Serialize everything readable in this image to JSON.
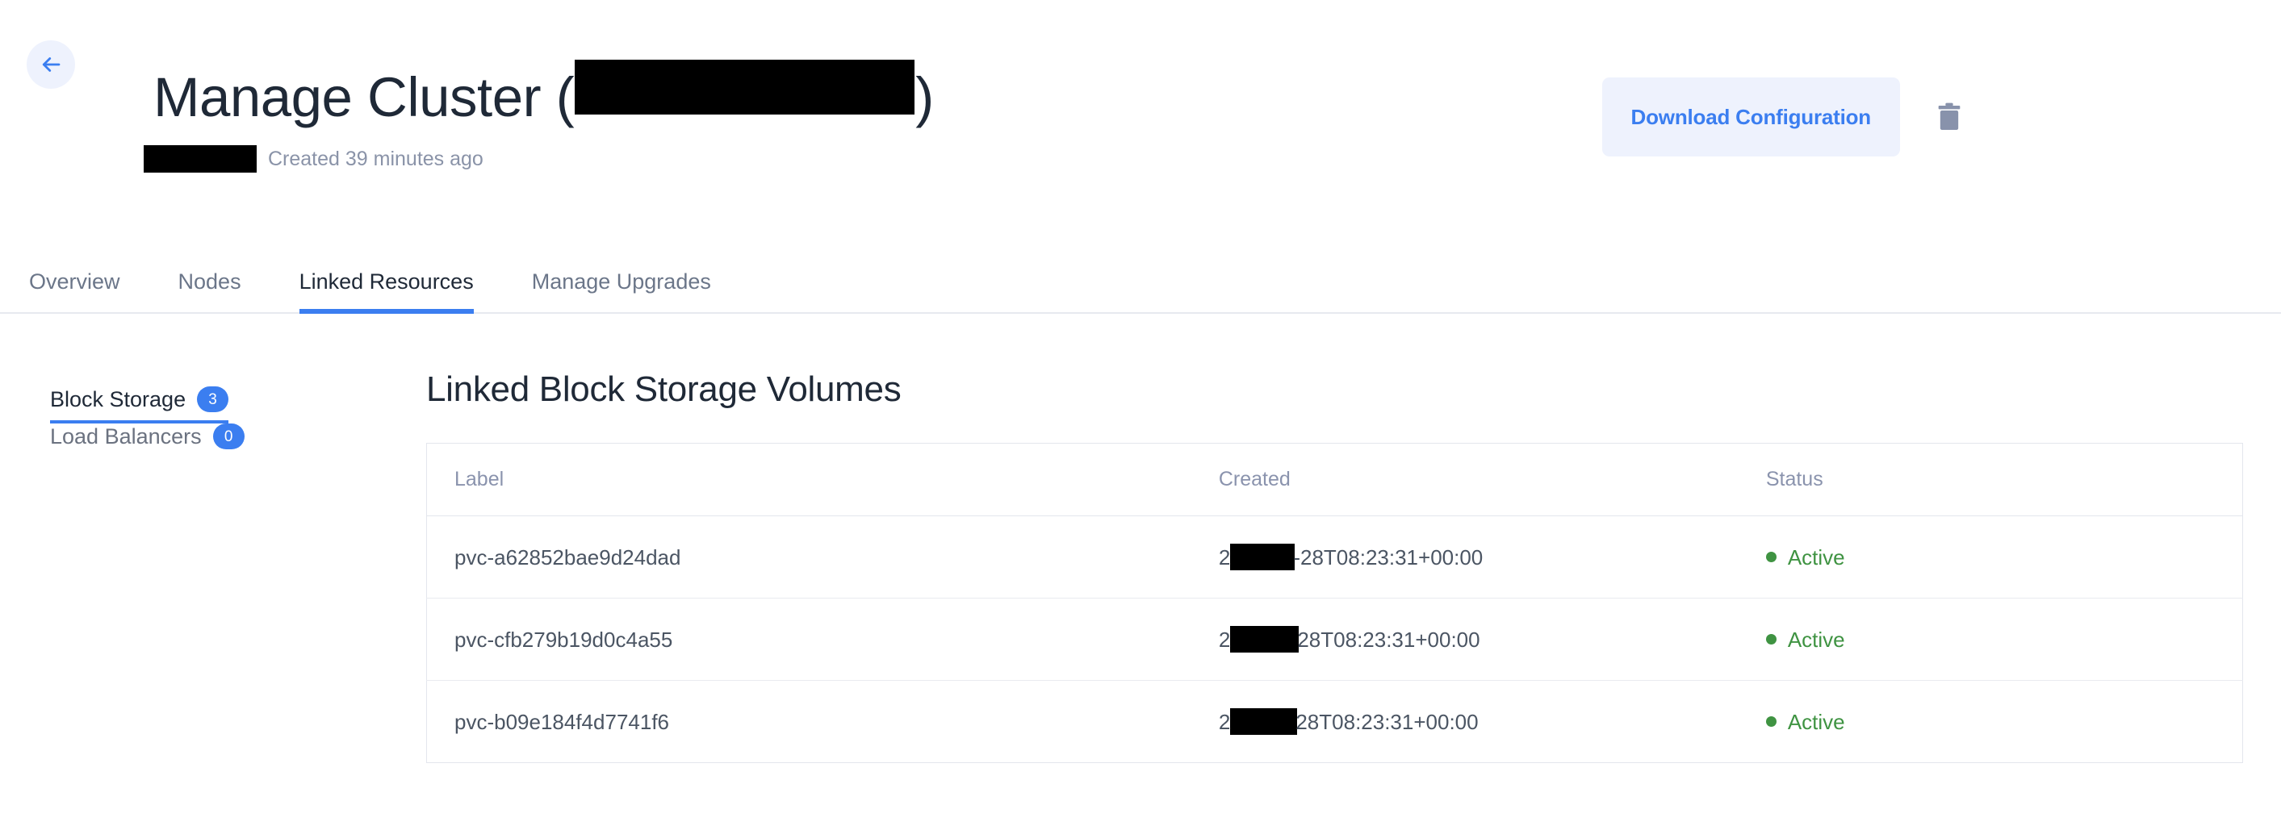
{
  "header": {
    "back_icon": "arrow-left-icon",
    "title_prefix": "Manage Cluster (",
    "title_suffix": ")",
    "title_redacted": true,
    "region_redacted": true,
    "subtitle": "Created 39 minutes ago",
    "download_label": "Download Configuration",
    "delete_icon": "trash-icon",
    "accent_color": "#3b7ef0",
    "button_bg": "#eef2fd"
  },
  "tabs": [
    {
      "label": "Overview",
      "active": false
    },
    {
      "label": "Nodes",
      "active": false
    },
    {
      "label": "Linked Resources",
      "active": true
    },
    {
      "label": "Manage Upgrades",
      "active": false
    }
  ],
  "side_nav": [
    {
      "label": "Block Storage",
      "count": "3",
      "active": true
    },
    {
      "label": "Load Balancers",
      "count": "0",
      "active": false
    }
  ],
  "main": {
    "panel_title": "Linked Block Storage Volumes",
    "table": {
      "columns": [
        "Label",
        "Created",
        "Status"
      ],
      "rows": [
        {
          "label": "pvc-a62852bae9d24dad",
          "created_prefix": "2",
          "created_redacted_width": 80,
          "created_suffix": "-28T08:23:31+00:00",
          "status": "Active",
          "status_color": "#3f9342"
        },
        {
          "label": "pvc-cfb279b19d0c4a55",
          "created_prefix": "2",
          "created_redacted_width": 85,
          "created_suffix": "28T08:23:31+00:00",
          "status": "Active",
          "status_color": "#3f9342"
        },
        {
          "label": "pvc-b09e184f4d7741f6",
          "created_prefix": "2",
          "created_redacted_width": 83,
          "created_suffix": "28T08:23:31+00:00",
          "status": "Active",
          "status_color": "#3f9342"
        }
      ]
    }
  }
}
